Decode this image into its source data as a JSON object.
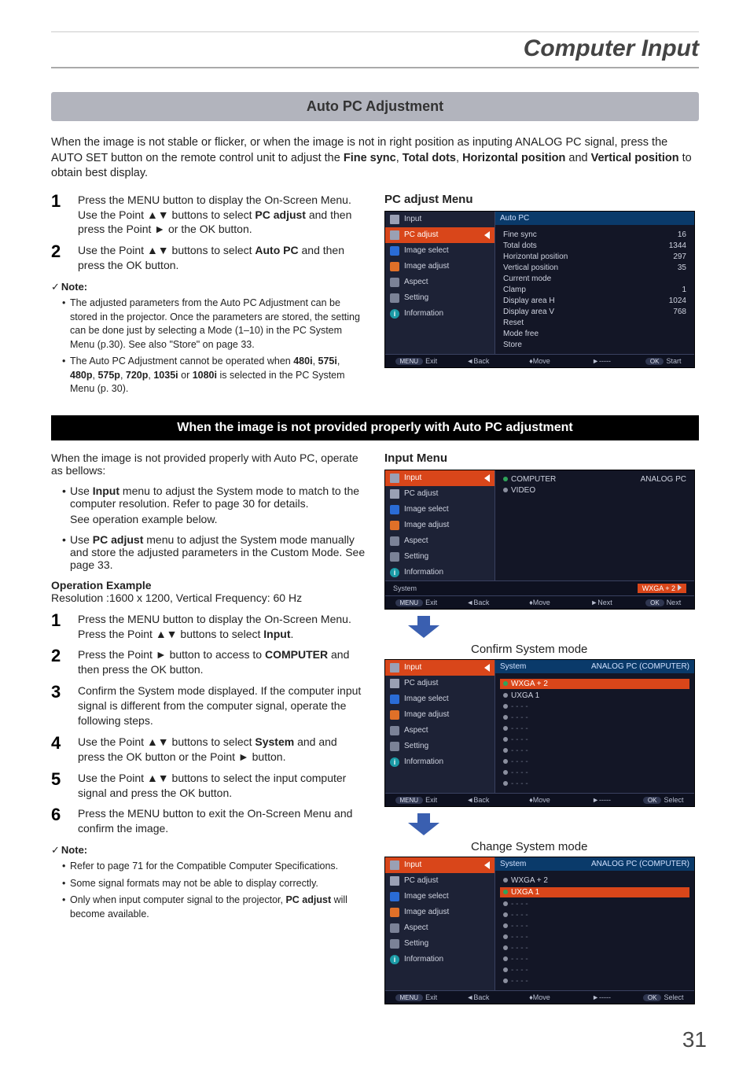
{
  "pageNumber": "31",
  "header": {
    "title": "Computer Input"
  },
  "section1": {
    "bar": "Auto PC Adjustment",
    "intro_pre": "When the image is not stable or flicker, or when the image is not in right position as inputing ANALOG PC signal, press the AUTO SET button on the remote control unit to adjust the ",
    "b1": "Fine sync",
    "sep1": ", ",
    "b2": "Total dots",
    "sep2": ", ",
    "b3": "Horizontal position",
    "sep3": " and ",
    "b4": "Vertical position",
    "intro_post": " to obtain best display.",
    "steps": [
      {
        "n": "1",
        "pre": "Press the MENU button to display the On-Screen Menu. Use the Point ▲▼ buttons to select ",
        "b": "PC adjust",
        "post": " and then press the Point ► or the OK button."
      },
      {
        "n": "2",
        "pre": "Use the Point ▲▼ buttons to select ",
        "b": "Auto PC",
        "post": " and then press the OK button."
      }
    ],
    "noteHead": "Note:",
    "notes": [
      "The adjusted parameters from the Auto PC Adjustment can be stored in the projector. Once the parameters are stored, the setting can be done just by selecting a Mode (1–10) in the PC System Menu (p.30). See also \"Store\" on page 33.",
      "The Auto PC Adjustment cannot be operated when 480i, 575i, 480p, 575p, 720p, 1035i or 1080i is selected in the PC System Menu (p. 30)."
    ]
  },
  "osdSide": [
    "Input",
    "PC adjust",
    "Image select",
    "Image adjust",
    "Aspect",
    "Setting",
    "Information"
  ],
  "pcAdjustMenu": {
    "title": "PC adjust Menu",
    "panelTitle": "Auto PC",
    "items": [
      {
        "k": "Fine sync",
        "v": "16"
      },
      {
        "k": "Total dots",
        "v": "1344"
      },
      {
        "k": "Horizontal position",
        "v": "297"
      },
      {
        "k": "Vertical position",
        "v": "35"
      },
      {
        "k": "Current mode",
        "v": ""
      },
      {
        "k": "Clamp",
        "v": "1"
      },
      {
        "k": "Display area H",
        "v": "1024"
      },
      {
        "k": "Display area V",
        "v": "768"
      },
      {
        "k": "Reset",
        "v": ""
      },
      {
        "k": "Mode free",
        "v": ""
      },
      {
        "k": "Store",
        "v": ""
      }
    ],
    "foot": {
      "exit": "Exit",
      "back": "Back",
      "move": "Move",
      "dash": "-----",
      "start": "Start"
    }
  },
  "blackBar": "When the image is not provided properly with Auto PC adjustment",
  "section2": {
    "intro": "When the image is not provided properly with Auto PC, operate as bellows:",
    "bullets": [
      {
        "pre": "Use ",
        "b": "Input",
        "post": " menu to adjust the System mode to match to the computer resolution. Refer to page 30 for details.",
        "tail": "See operation example below."
      },
      {
        "pre": "Use ",
        "b": "PC adjust",
        "post": " menu to adjust the System mode manually and store the adjusted parameters in the Custom Mode. See page 33."
      }
    ],
    "opExHead": "Operation Example",
    "opExSub": "Resolution :1600 x 1200, Vertical Frequency: 60 Hz",
    "steps": [
      {
        "n": "1",
        "pre": "Press the MENU button to display the On-Screen Menu. Press the Point ▲▼ buttons to select ",
        "b": "Input",
        "post": "."
      },
      {
        "n": "2",
        "pre": "Press the Point ► button to access to ",
        "b": "COMPUTER",
        "post": " and then press the OK button."
      },
      {
        "n": "3",
        "pre": "Confirm the System mode displayed. If the computer input signal is different from the computer signal, operate the following steps.",
        "b": "",
        "post": ""
      },
      {
        "n": "4",
        "pre": "Use the Point ▲▼ buttons to select ",
        "b": "System",
        "post": " and and press the OK button or the  Point ► button."
      },
      {
        "n": "5",
        "pre": "Use the Point ▲▼ buttons to select the input computer signal and press the OK button.",
        "b": "",
        "post": ""
      },
      {
        "n": "6",
        "pre": "Press the MENU button to exit the On-Screen Menu and confirm the image.",
        "b": "",
        "post": ""
      }
    ],
    "noteHead": "Note:",
    "notes": [
      "Refer to page 71 for the Compatible Computer Specifications.",
      "Some signal formats may not be able to display correctly.",
      "Only when input computer signal to the projector, PC adjust will become available."
    ]
  },
  "inputMenu": {
    "title": "Input Menu",
    "rightTop": "ANALOG PC",
    "items": [
      "COMPUTER",
      "VIDEO"
    ],
    "systemLabel": "System",
    "systemVal": "WXGA + 2",
    "foot": {
      "exit": "Exit",
      "back": "Back",
      "move": "Move",
      "next": "Next",
      "ok": "Next"
    }
  },
  "confirmCaption": "Confirm System mode",
  "systemMenu1": {
    "header": "System",
    "headerRight": "ANALOG PC (COMPUTER)",
    "sel": "WXGA + 2",
    "opt2": "UXGA 1",
    "foot": {
      "exit": "Exit",
      "back": "Back",
      "move": "Move",
      "dash": "-----",
      "ok": "Select"
    }
  },
  "changeCaption": "Change System mode",
  "systemMenu2": {
    "header": "System",
    "headerRight": "ANALOG PC (COMPUTER)",
    "opt1": "WXGA + 2",
    "sel": "UXGA 1",
    "foot": {
      "exit": "Exit",
      "back": "Back",
      "move": "Move",
      "dash": "-----",
      "ok": "Select"
    }
  },
  "footBtn": {
    "menu": "MENU",
    "ok": "OK"
  },
  "dash": "- - - -"
}
